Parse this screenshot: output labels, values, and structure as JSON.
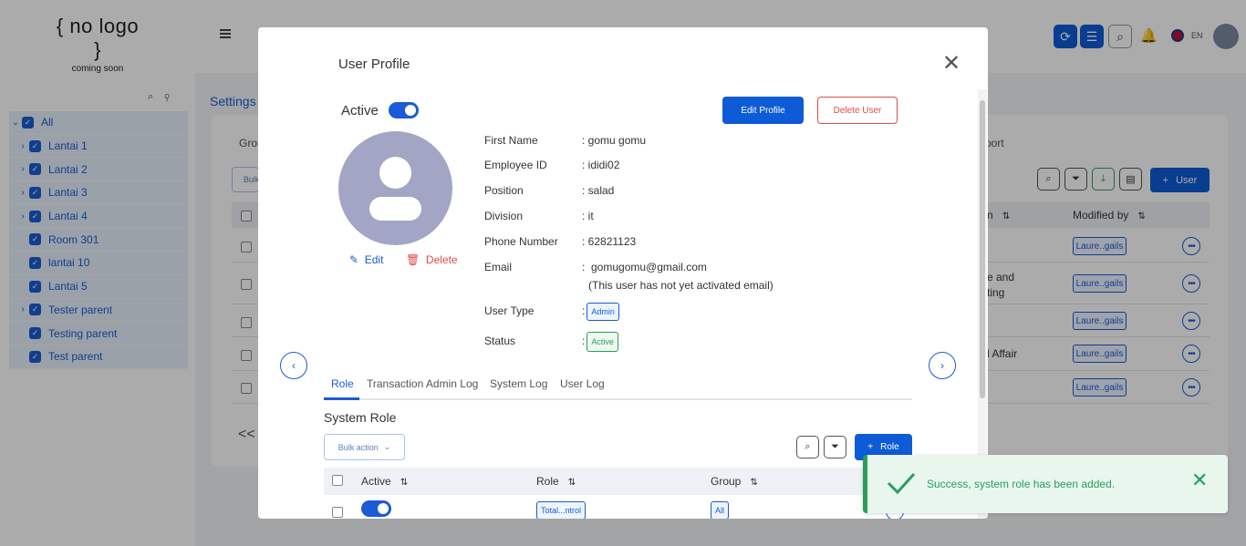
{
  "logo": {
    "main": "{ no logo }",
    "sub": "coming soon"
  },
  "topbar": {
    "lang": "EN"
  },
  "sidebar": {
    "items": [
      {
        "label": "All",
        "expandable": true,
        "expanded": true
      },
      {
        "label": "Lantai 1",
        "expandable": true
      },
      {
        "label": "Lantai 2",
        "expandable": true
      },
      {
        "label": "Lantai 3",
        "expandable": true
      },
      {
        "label": "Lantai 4",
        "expandable": true
      },
      {
        "label": "Room 301",
        "expandable": false
      },
      {
        "label": "lantai 10",
        "expandable": false
      },
      {
        "label": "Lantai 5",
        "expandable": false
      },
      {
        "label": "Tester parent",
        "expandable": true
      },
      {
        "label": "Testing parent",
        "expandable": false
      },
      {
        "label": "Test parent",
        "expandable": false
      }
    ]
  },
  "background": {
    "breadcrumb": "Settings",
    "tab_left": "Grou",
    "tab_right": "port",
    "bulk": "Bulk",
    "user_button": "User",
    "col_partial": "n",
    "col_modified": "Modified by",
    "rows": [
      {
        "text": "",
        "modified": "Laure..gails"
      },
      {
        "text": "e and\nting",
        "modified": "Laure..gails"
      },
      {
        "text": "",
        "modified": "Laure..gails"
      },
      {
        "text": "l Affair",
        "modified": "Laure..gails"
      },
      {
        "text": "",
        "modified": "Laure..gails"
      }
    ],
    "pager": "<<"
  },
  "modal": {
    "title": "User Profile",
    "active_label": "Active",
    "edit_profile": "Edit Profile",
    "delete_user": "Delete User",
    "pic_edit": "Edit",
    "pic_delete": "Delete",
    "fields": {
      "first_name": {
        "label": "First Name",
        "value": ": gomu gomu"
      },
      "employee_id": {
        "label": "Employee ID",
        "value": ": ididi02"
      },
      "position": {
        "label": "Position",
        "value": ": salad"
      },
      "division": {
        "label": "Division",
        "value": ": it"
      },
      "phone": {
        "label": "Phone Number",
        "value": ": 62821123"
      },
      "email": {
        "label": "Email",
        "value": ":  gomugomu@gmail.com",
        "note": "(This user has not yet activated email)"
      },
      "user_type": {
        "label": "User Type",
        "value": "Admin"
      },
      "status": {
        "label": "Status",
        "value": "Active"
      }
    },
    "tabs": [
      "Role",
      "Transaction Admin Log",
      "System Log",
      "User Log"
    ],
    "active_tab": "Role",
    "system_role_title": "System Role",
    "bulk_action": "Bulk action",
    "role_button": "Role",
    "columns": [
      "Active",
      "Role",
      "Group"
    ],
    "rows": [
      {
        "active": true,
        "role": "Total...ntrol",
        "group": "All"
      }
    ]
  },
  "toast": {
    "message": "Success, system role has been added."
  },
  "colors": {
    "primary": "#0d5bd6",
    "danger": "#e04a4a",
    "success": "#2a9d5c"
  }
}
